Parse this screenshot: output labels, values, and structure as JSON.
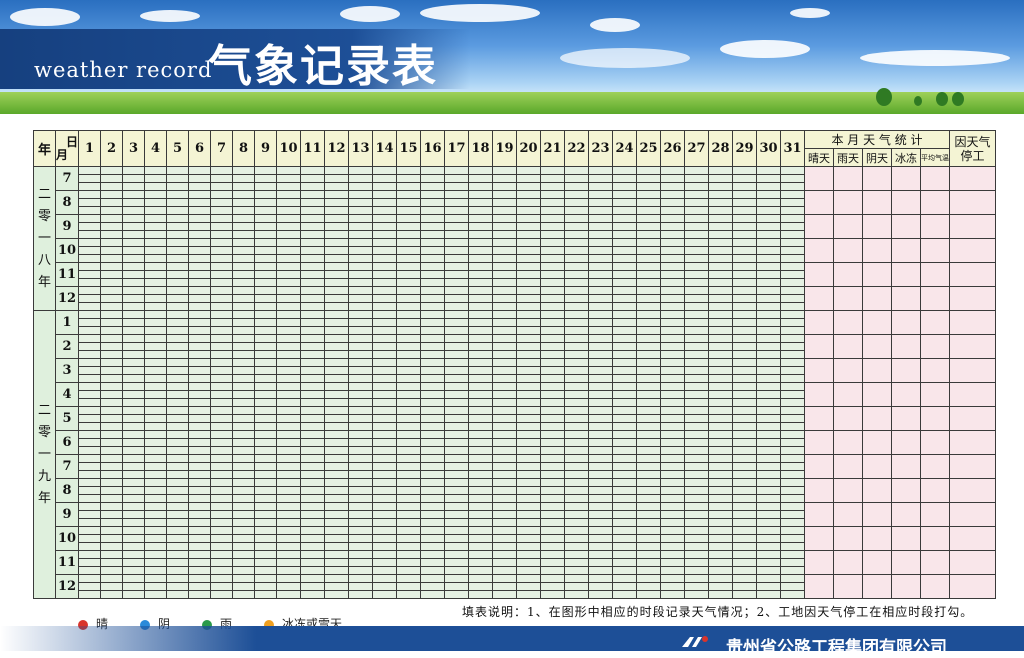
{
  "header": {
    "title_en": "weather record",
    "title_cn": "气象记录表"
  },
  "table": {
    "corner_year": "年",
    "corner_day": "日",
    "corner_month": "月",
    "days": [
      "1",
      "2",
      "3",
      "4",
      "5",
      "6",
      "7",
      "8",
      "9",
      "10",
      "11",
      "12",
      "13",
      "14",
      "15",
      "16",
      "17",
      "18",
      "19",
      "20",
      "21",
      "22",
      "23",
      "24",
      "25",
      "26",
      "27",
      "28",
      "29",
      "30",
      "31"
    ],
    "stats_title": "本 月 天 气 统 计",
    "stats_columns": [
      "晴天",
      "雨天",
      "阴天",
      "冰冻",
      "平均气温"
    ],
    "stop_column": "因天气停工",
    "years": [
      {
        "label": "二零一八年",
        "months": [
          "7",
          "8",
          "9",
          "10",
          "11",
          "12"
        ]
      },
      {
        "label": "二零一九年",
        "months": [
          "1",
          "2",
          "3",
          "4",
          "5",
          "6",
          "7",
          "8",
          "9",
          "10",
          "11",
          "12"
        ]
      }
    ]
  },
  "legend": {
    "items": [
      {
        "label": "晴",
        "color": "#d9342b"
      },
      {
        "label": "阴",
        "color": "#2b8ad9"
      },
      {
        "label": "雨",
        "color": "#2a9a4a"
      },
      {
        "label": "冰冻或雪天",
        "color": "#f0a020"
      }
    ]
  },
  "instructions": "填表说明：1、在图形中相应的时段记录天气情况；2、工地因天气停工在相应时段打勾。",
  "footer": {
    "company": "贵州省公路工程集团有限公司"
  },
  "colors": {
    "banner_blue": "#1d4f97",
    "grid_green": "#e5f1e3",
    "stats_pink": "#f9e6ea",
    "header_yellow": "#f4f4d4"
  }
}
